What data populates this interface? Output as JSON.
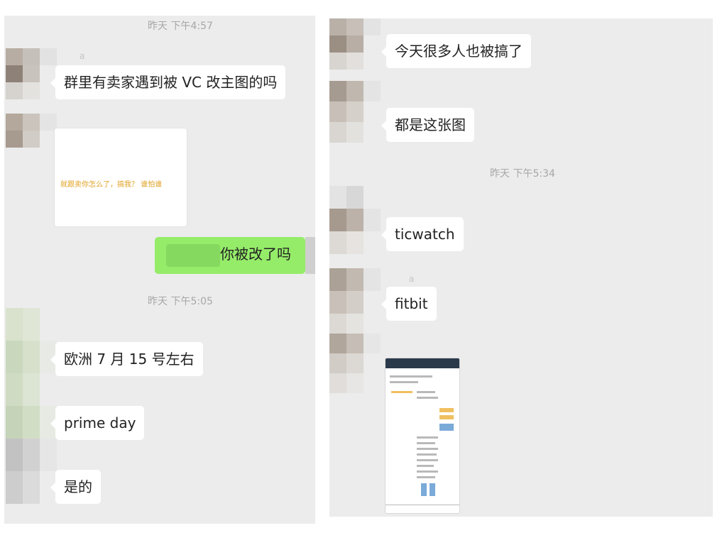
{
  "left": {
    "timestamps": [
      "昨天 下午4:57",
      "昨天 下午5:05"
    ],
    "name_blur": "a",
    "messages": {
      "m1": "群里有卖家遇到被 VC 改主图的吗",
      "image_caption": "就跟卖你怎么了，搞我？ 谁怕谁",
      "self_msg": "你被改了吗",
      "m2": "欧洲 7 月 15 号左右",
      "m3": "prime day",
      "m4": "是的"
    }
  },
  "right": {
    "timestamps": [
      "昨天 下午5:34"
    ],
    "name_blur": "a",
    "messages": {
      "m1": "今天很多人也被搞了",
      "m2": "都是这张图",
      "m3": "ticwatch",
      "m4": "fitbit"
    }
  },
  "colors": {
    "panel_bg": "#ececec",
    "self_bubble": "#95ec69",
    "bubble": "#ffffff",
    "timestamp": "#a7a7a7"
  },
  "icons": [
    "pixelated-avatar",
    "image-thumbnail",
    "screenshot-thumbnail"
  ]
}
